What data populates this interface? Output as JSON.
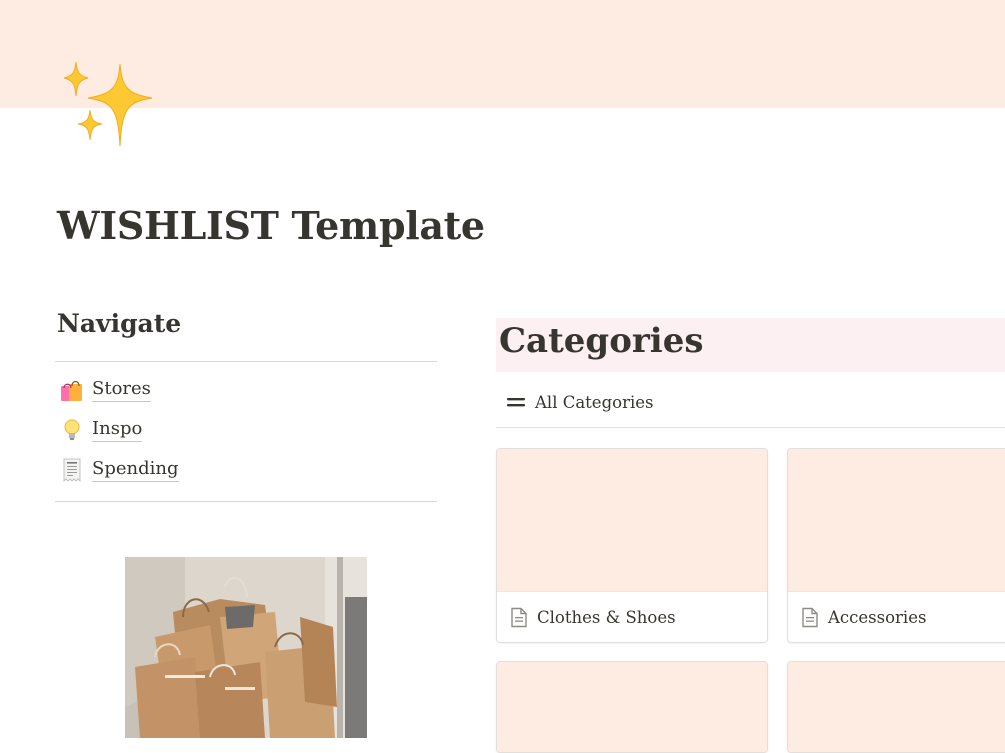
{
  "page": {
    "title": "WISHLIST Template",
    "icon": "sparkles-icon",
    "cover_color": "#feece2"
  },
  "navigate": {
    "heading": "Navigate",
    "links": [
      {
        "label": "Stores",
        "icon": "shopping-bags-icon"
      },
      {
        "label": "Inspo",
        "icon": "light-bulb-icon"
      },
      {
        "label": "Spending",
        "icon": "receipt-icon"
      }
    ]
  },
  "image": {
    "description_icon": "shopping-bags-photo"
  },
  "categories": {
    "heading": "Categories",
    "header_color": "#fdf0f3",
    "view_tab": {
      "label": "All Categories",
      "icon": "list-icon"
    },
    "cards": [
      {
        "label": "Clothes & Shoes",
        "icon": "document-icon",
        "cover_color": "#feece2"
      },
      {
        "label": "Accessories",
        "icon": "document-icon",
        "cover_color": "#feece2"
      }
    ]
  }
}
